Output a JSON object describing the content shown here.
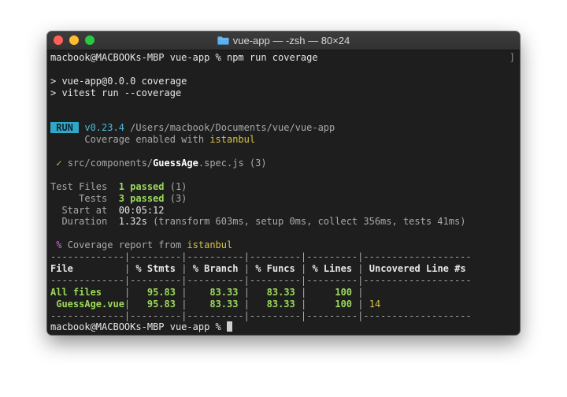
{
  "window": {
    "title": "vue-app — -zsh — 80×24",
    "title_icon": "folder-icon",
    "controls": [
      "close",
      "minimize",
      "zoom"
    ]
  },
  "terminal": {
    "prompt": "macbook@MACBOOKs-MBP vue-app % ",
    "command": "npm run coverage",
    "right_bracket": "]",
    "npm_lines": [
      "> vue-app@0.0.0 coverage",
      "> vitest run --coverage"
    ],
    "run_badge": " RUN ",
    "version": "v0.23.4",
    "cwd": "/Users/macbook/Documents/vue/vue-app",
    "coverage_enabled_text": "Coverage enabled with ",
    "coverage_provider": "istanbul",
    "checkmark": "✓",
    "spec_dir": "src/components/",
    "spec_name": "GuessAge",
    "spec_ext": ".spec.js",
    "spec_count": "(3)",
    "summary": {
      "test_files_label": "Test Files",
      "test_files_passed": "1 passed",
      "test_files_total": "(1)",
      "tests_label": "Tests",
      "tests_passed": "3 passed",
      "tests_total": "(3)",
      "start_label": "Start at",
      "start_value": "00:05:12",
      "duration_label": "Duration",
      "duration_value": "1.32s",
      "duration_detail": "(transform 603ms, setup 0ms, collect 356ms, tests 41ms)"
    },
    "report_marker": "%",
    "report_text": "Coverage report from ",
    "report_provider": "istanbul",
    "table": {
      "separator": "-------------|---------|----------|---------|---------|-------------------",
      "headers": [
        "File",
        "% Stmts",
        "% Branch",
        "% Funcs",
        "% Lines",
        "Uncovered Line #s"
      ],
      "rows": [
        {
          "file": "All files",
          "stmts": "95.83",
          "branch": "83.33",
          "funcs": "83.33",
          "lines": "100",
          "uncovered": ""
        },
        {
          "file": " GuessAge.vue",
          "stmts": "95.83",
          "branch": "83.33",
          "funcs": "83.33",
          "lines": "100",
          "uncovered": "14"
        }
      ]
    }
  }
}
